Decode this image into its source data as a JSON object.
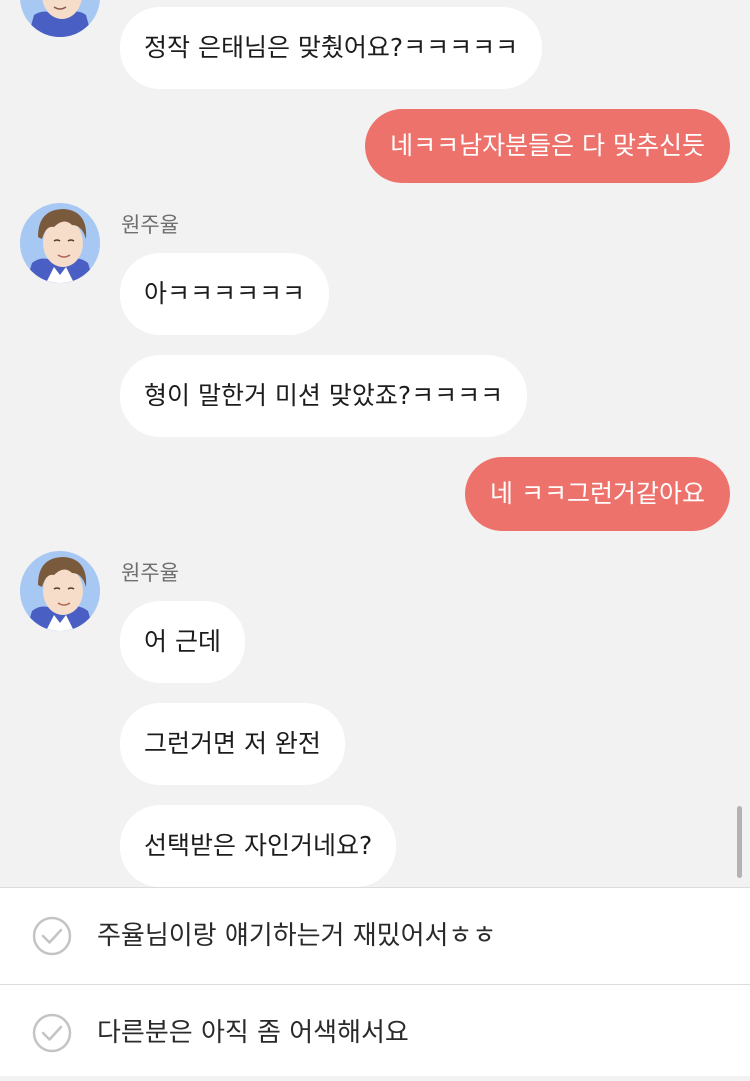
{
  "chat": {
    "messages": [
      {
        "sender": "other",
        "text": "정작 은태님은 맞췄어요?ㅋㅋㅋㅋㅋ"
      },
      {
        "sender": "me",
        "text": "네ㅋㅋ남자분들은 다 맞추신듯"
      },
      {
        "sender": "other",
        "name": "원주율",
        "text": "아ㅋㅋㅋㅋㅋㅋ"
      },
      {
        "sender": "other",
        "text": "형이 말한거 미션 맞았죠?ㅋㅋㅋㅋ"
      },
      {
        "sender": "me",
        "text": "네 ㅋㅋ그런거같아요"
      },
      {
        "sender": "other",
        "name": "원주율",
        "text": "어 근데"
      },
      {
        "sender": "other",
        "text": "그런거면 저 완전"
      },
      {
        "sender": "other",
        "text": "선택받은 자인거네요?"
      }
    ]
  },
  "choices": [
    {
      "label": "주율님이랑 얘기하는거 재밌어서ㅎㅎ",
      "icon": "check-circle-icon"
    },
    {
      "label": "다른분은 아직 좀 어색해서요",
      "icon": "check-circle-icon"
    }
  ],
  "colors": {
    "background": "#f2f2f2",
    "my_bubble": "#ee726c",
    "other_bubble": "#ffffff",
    "divider": "#dddddd"
  }
}
